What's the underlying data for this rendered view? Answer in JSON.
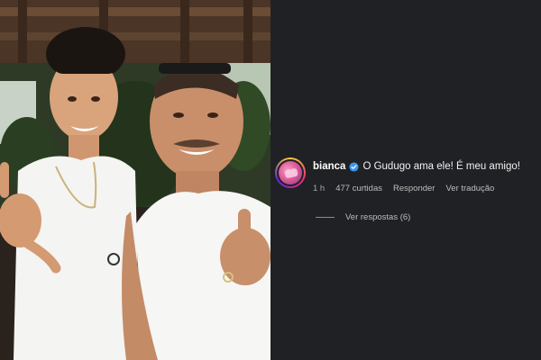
{
  "comment": {
    "username": "bianca",
    "text": "O Gudugo ama ele! É meu amigo!",
    "time": "1 h",
    "likes": "477 curtidas",
    "reply_label": "Responder",
    "translate_label": "Ver tradução",
    "view_replies_label": "Ver respostas (6)",
    "verified_color": "#3897f0"
  },
  "photo": {
    "icon": "photo-two-men-thumbs-up"
  }
}
